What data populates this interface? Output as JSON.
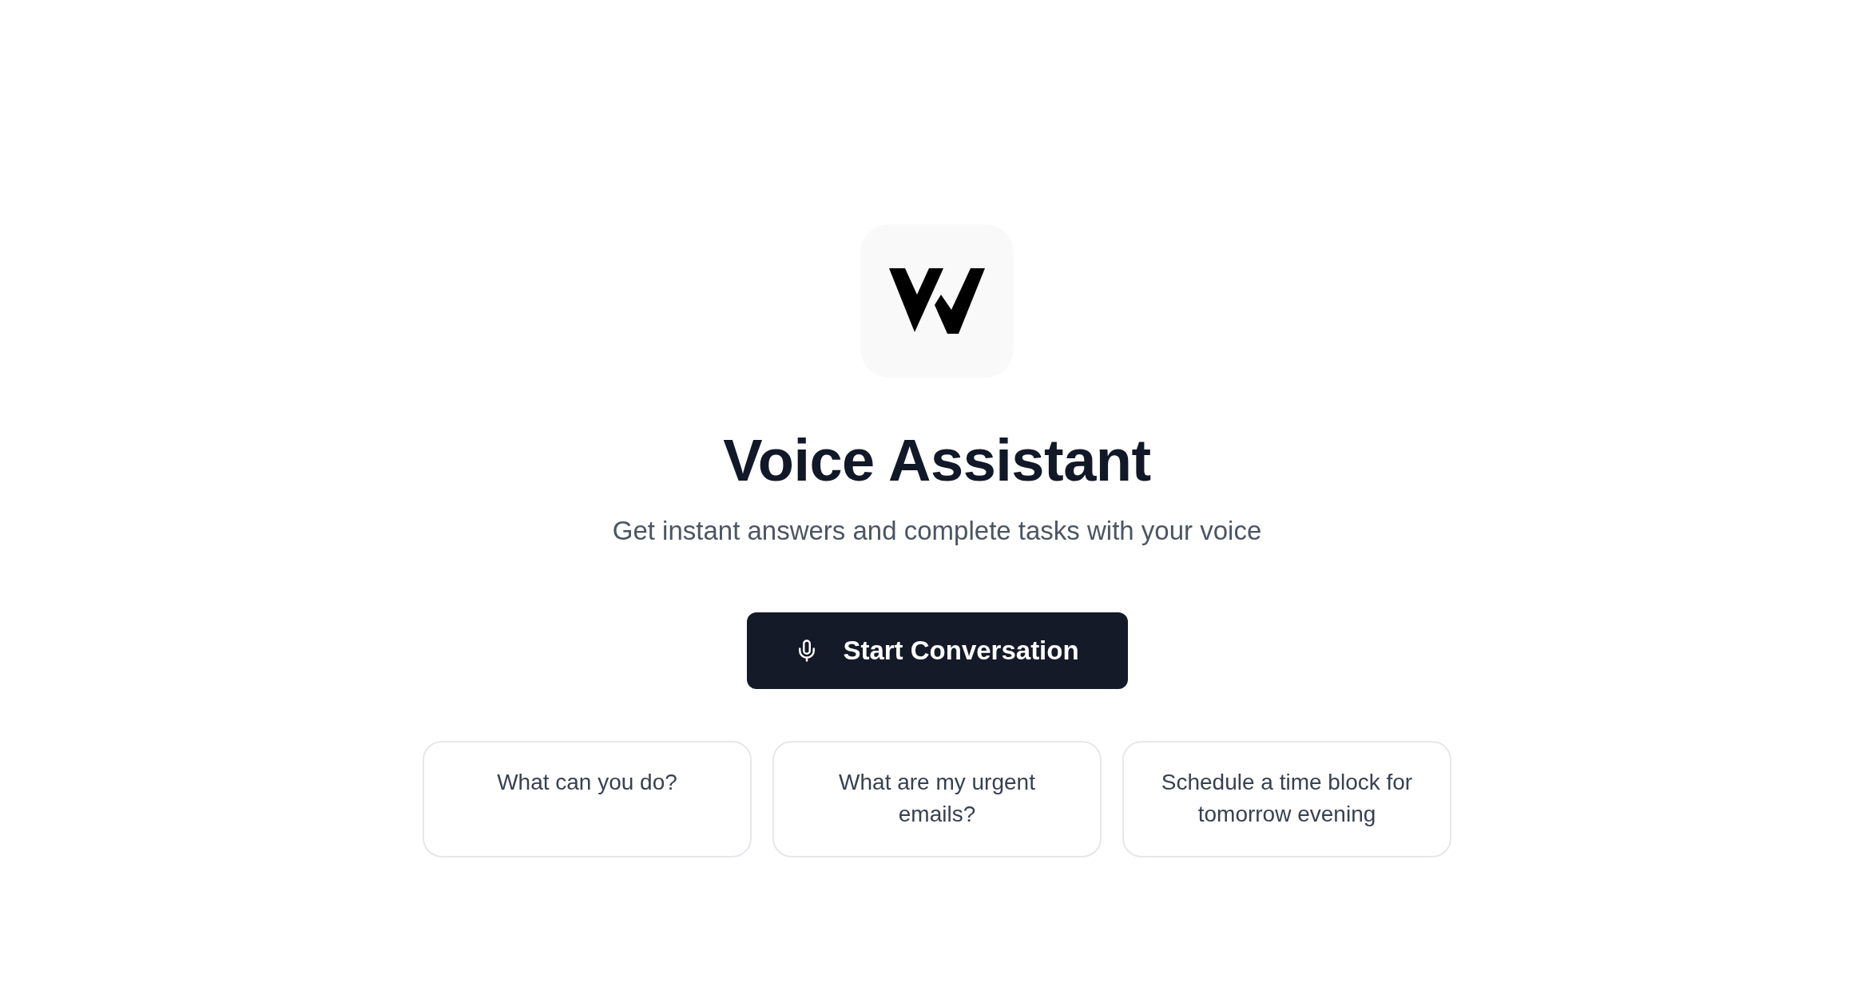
{
  "header": {
    "title": "Voice Assistant",
    "subtitle": "Get instant answers and complete tasks with your voice"
  },
  "primary_action": {
    "label": "Start Conversation"
  },
  "suggestions": [
    "What can you do?",
    "What are my urgent emails?",
    "Schedule a time block for tomorrow evening"
  ]
}
